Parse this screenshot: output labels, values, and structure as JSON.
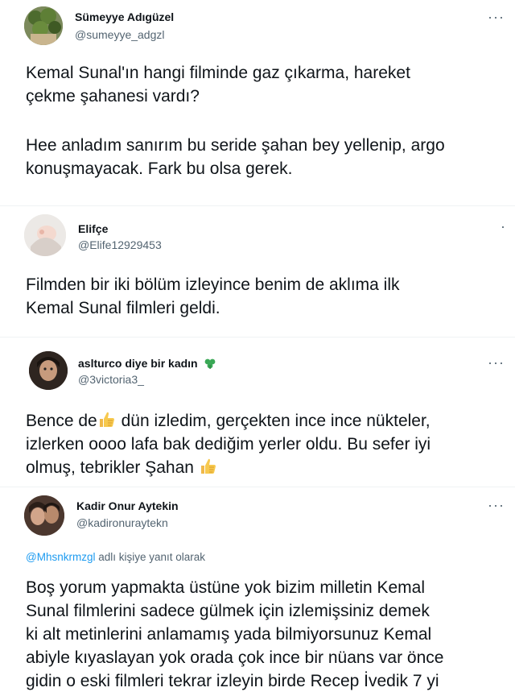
{
  "tweets": [
    {
      "name": "Sümeyye Adıgüzel",
      "handle": "@sumeyye_adgzl",
      "more": "···",
      "lines": [
        "Kemal Sunal'ın hangi filminde gaz çıkarma, hareket",
        "çekme şahanesi vardı?",
        "",
        "Hee anladım sanırım bu seride şahan bey yellenip, argo",
        "konuşmayacak. Fark bu olsa gerek."
      ]
    },
    {
      "name": "Elifçe",
      "handle": "@Elife12929453",
      "more": "·",
      "lines": [
        "Filmden bir iki bölüm izleyince benim de aklıma ilk",
        "Kemal Sunal filmleri geldi."
      ]
    },
    {
      "name": "aslturco diye bir kadın",
      "handle": "@3victoria3_",
      "more": "···",
      "emoji": "shamrock-icon",
      "lines": [
        [
          "Bence de",
          "thumbs-up-icon",
          " dün izledim, gerçekten ince ince nükteler,"
        ],
        "izlerken oooo lafa bak dediğim yerler oldu. Bu sefer iyi",
        [
          "olmuş, tebrikler Şahan ",
          "thumbs-up-icon"
        ]
      ]
    },
    {
      "name": "Kadir Onur Aytekin",
      "handle": "@kadironuraytekn",
      "more": "···",
      "reply_mention": "@Mhsnkrmzgl",
      "reply_suffix": " adlı kişiye yanıt olarak",
      "lines": [
        "Boş yorum yapmakta üstüne yok bizim milletin Kemal",
        "Sunal filmlerini sadece gülmek için izlemişsiniz demek",
        "ki alt metinlerini anlamamış yada bilmiyorsunuz Kemal",
        "abiyle kıyaslayan yok orada çok ince bir nüans var önce",
        "gidin o eski filmleri tekrar izleyin birde Recep İvedik 7 yi"
      ]
    }
  ],
  "colors": {
    "text": "#0f1419",
    "secondary": "#536471",
    "link": "#1d9bf0",
    "divider": "#eff3f4"
  }
}
